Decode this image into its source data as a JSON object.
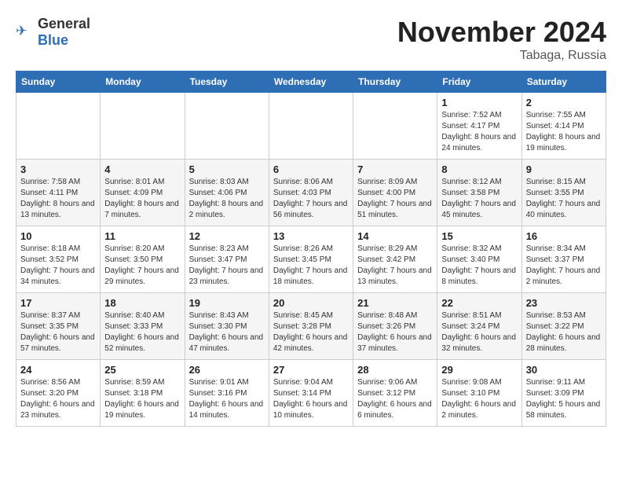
{
  "logo": {
    "general": "General",
    "blue": "Blue"
  },
  "title": "November 2024",
  "subtitle": "Tabaga, Russia",
  "days_of_week": [
    "Sunday",
    "Monday",
    "Tuesday",
    "Wednesday",
    "Thursday",
    "Friday",
    "Saturday"
  ],
  "weeks": [
    [
      {
        "day": "",
        "info": ""
      },
      {
        "day": "",
        "info": ""
      },
      {
        "day": "",
        "info": ""
      },
      {
        "day": "",
        "info": ""
      },
      {
        "day": "",
        "info": ""
      },
      {
        "day": "1",
        "info": "Sunrise: 7:52 AM\nSunset: 4:17 PM\nDaylight: 8 hours and 24 minutes."
      },
      {
        "day": "2",
        "info": "Sunrise: 7:55 AM\nSunset: 4:14 PM\nDaylight: 8 hours and 19 minutes."
      }
    ],
    [
      {
        "day": "3",
        "info": "Sunrise: 7:58 AM\nSunset: 4:11 PM\nDaylight: 8 hours and 13 minutes."
      },
      {
        "day": "4",
        "info": "Sunrise: 8:01 AM\nSunset: 4:09 PM\nDaylight: 8 hours and 7 minutes."
      },
      {
        "day": "5",
        "info": "Sunrise: 8:03 AM\nSunset: 4:06 PM\nDaylight: 8 hours and 2 minutes."
      },
      {
        "day": "6",
        "info": "Sunrise: 8:06 AM\nSunset: 4:03 PM\nDaylight: 7 hours and 56 minutes."
      },
      {
        "day": "7",
        "info": "Sunrise: 8:09 AM\nSunset: 4:00 PM\nDaylight: 7 hours and 51 minutes."
      },
      {
        "day": "8",
        "info": "Sunrise: 8:12 AM\nSunset: 3:58 PM\nDaylight: 7 hours and 45 minutes."
      },
      {
        "day": "9",
        "info": "Sunrise: 8:15 AM\nSunset: 3:55 PM\nDaylight: 7 hours and 40 minutes."
      }
    ],
    [
      {
        "day": "10",
        "info": "Sunrise: 8:18 AM\nSunset: 3:52 PM\nDaylight: 7 hours and 34 minutes."
      },
      {
        "day": "11",
        "info": "Sunrise: 8:20 AM\nSunset: 3:50 PM\nDaylight: 7 hours and 29 minutes."
      },
      {
        "day": "12",
        "info": "Sunrise: 8:23 AM\nSunset: 3:47 PM\nDaylight: 7 hours and 23 minutes."
      },
      {
        "day": "13",
        "info": "Sunrise: 8:26 AM\nSunset: 3:45 PM\nDaylight: 7 hours and 18 minutes."
      },
      {
        "day": "14",
        "info": "Sunrise: 8:29 AM\nSunset: 3:42 PM\nDaylight: 7 hours and 13 minutes."
      },
      {
        "day": "15",
        "info": "Sunrise: 8:32 AM\nSunset: 3:40 PM\nDaylight: 7 hours and 8 minutes."
      },
      {
        "day": "16",
        "info": "Sunrise: 8:34 AM\nSunset: 3:37 PM\nDaylight: 7 hours and 2 minutes."
      }
    ],
    [
      {
        "day": "17",
        "info": "Sunrise: 8:37 AM\nSunset: 3:35 PM\nDaylight: 6 hours and 57 minutes."
      },
      {
        "day": "18",
        "info": "Sunrise: 8:40 AM\nSunset: 3:33 PM\nDaylight: 6 hours and 52 minutes."
      },
      {
        "day": "19",
        "info": "Sunrise: 8:43 AM\nSunset: 3:30 PM\nDaylight: 6 hours and 47 minutes."
      },
      {
        "day": "20",
        "info": "Sunrise: 8:45 AM\nSunset: 3:28 PM\nDaylight: 6 hours and 42 minutes."
      },
      {
        "day": "21",
        "info": "Sunrise: 8:48 AM\nSunset: 3:26 PM\nDaylight: 6 hours and 37 minutes."
      },
      {
        "day": "22",
        "info": "Sunrise: 8:51 AM\nSunset: 3:24 PM\nDaylight: 6 hours and 32 minutes."
      },
      {
        "day": "23",
        "info": "Sunrise: 8:53 AM\nSunset: 3:22 PM\nDaylight: 6 hours and 28 minutes."
      }
    ],
    [
      {
        "day": "24",
        "info": "Sunrise: 8:56 AM\nSunset: 3:20 PM\nDaylight: 6 hours and 23 minutes."
      },
      {
        "day": "25",
        "info": "Sunrise: 8:59 AM\nSunset: 3:18 PM\nDaylight: 6 hours and 19 minutes."
      },
      {
        "day": "26",
        "info": "Sunrise: 9:01 AM\nSunset: 3:16 PM\nDaylight: 6 hours and 14 minutes."
      },
      {
        "day": "27",
        "info": "Sunrise: 9:04 AM\nSunset: 3:14 PM\nDaylight: 6 hours and 10 minutes."
      },
      {
        "day": "28",
        "info": "Sunrise: 9:06 AM\nSunset: 3:12 PM\nDaylight: 6 hours and 6 minutes."
      },
      {
        "day": "29",
        "info": "Sunrise: 9:08 AM\nSunset: 3:10 PM\nDaylight: 6 hours and 2 minutes."
      },
      {
        "day": "30",
        "info": "Sunrise: 9:11 AM\nSunset: 3:09 PM\nDaylight: 5 hours and 58 minutes."
      }
    ]
  ]
}
